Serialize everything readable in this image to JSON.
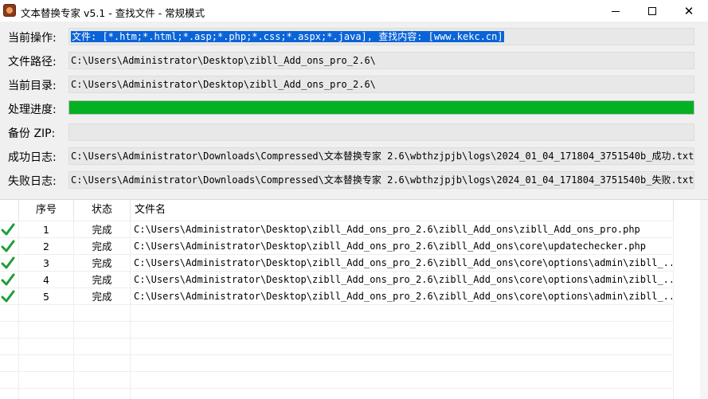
{
  "window": {
    "title": "文本替换专家 v5.1  -  查找文件 - 常规模式",
    "controls": {
      "minimize": "minimize-icon",
      "maximize": "maximize-icon",
      "close": "close-icon"
    }
  },
  "form": {
    "current_operation": {
      "label": "当前操作:",
      "value": "文件: [*.htm;*.html;*.asp;*.php;*.css;*.aspx;*.java], 查找内容: [www.kekc.cn]"
    },
    "file_path": {
      "label": "文件路径:",
      "value": "C:\\Users\\Administrator\\Desktop\\zibll_Add_ons_pro_2.6\\"
    },
    "current_dir": {
      "label": "当前目录:",
      "value": "C:\\Users\\Administrator\\Desktop\\zibll_Add_ons_pro_2.6\\"
    },
    "progress": {
      "label": "处理进度:",
      "percent": 100,
      "color": "#06b025"
    },
    "backup_zip": {
      "label": "备份 ZIP:",
      "value": ""
    },
    "success_log": {
      "label": "成功日志:",
      "value": "C:\\Users\\Administrator\\Downloads\\Compressed\\文本替换专家 2.6\\wbthzjpjb\\logs\\2024_01_04_171804_3751540b_成功.txt"
    },
    "failure_log": {
      "label": "失败日志:",
      "value": "C:\\Users\\Administrator\\Downloads\\Compressed\\文本替换专家 2.6\\wbthzjpjb\\logs\\2024_01_04_171804_3751540b_失败.txt"
    }
  },
  "table": {
    "columns": [
      "序号",
      "状态",
      "文件名"
    ],
    "rows": [
      {
        "num": "1",
        "status": "完成",
        "file": "C:\\Users\\Administrator\\Desktop\\zibll_Add_ons_pro_2.6\\zibll_Add_ons\\zibll_Add_ons_pro.php"
      },
      {
        "num": "2",
        "status": "完成",
        "file": "C:\\Users\\Administrator\\Desktop\\zibll_Add_ons_pro_2.6\\zibll_Add_ons\\core\\updatechecker.php"
      },
      {
        "num": "3",
        "status": "完成",
        "file": "C:\\Users\\Administrator\\Desktop\\zibll_Add_ons_pro_2.6\\zibll_Add_ons\\core\\options\\admin\\zibll_..."
      },
      {
        "num": "4",
        "status": "完成",
        "file": "C:\\Users\\Administrator\\Desktop\\zibll_Add_ons_pro_2.6\\zibll_Add_ons\\core\\options\\admin\\zibll_..."
      },
      {
        "num": "5",
        "status": "完成",
        "file": "C:\\Users\\Administrator\\Desktop\\zibll_Add_ons_pro_2.6\\zibll_Add_ons\\core\\options\\admin\\zibll_..."
      }
    ],
    "row_icon": "checkmark-icon",
    "accent_color": "#1f9d3a"
  }
}
